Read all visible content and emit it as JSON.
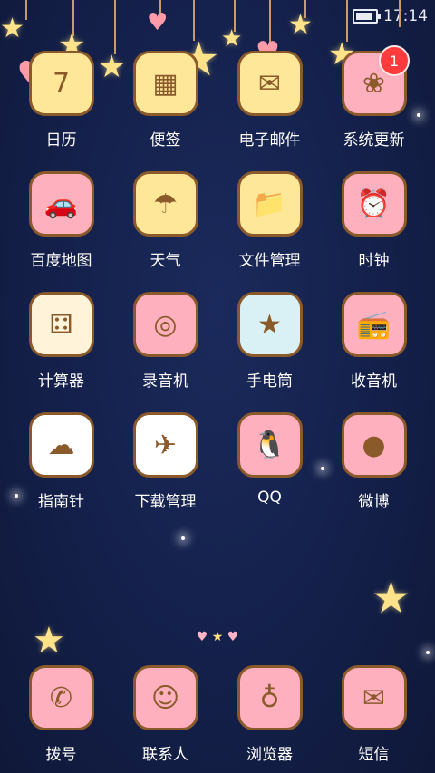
{
  "status_bar": {
    "time": "17:14"
  },
  "apps": [
    {
      "label": "日历",
      "icon": "calendar-icon",
      "glyph": "7",
      "bg": "#ffe79a"
    },
    {
      "label": "便签",
      "icon": "notepad-icon",
      "glyph": "▦",
      "bg": "#ffe79a"
    },
    {
      "label": "电子邮件",
      "icon": "mail-icon",
      "glyph": "✉",
      "bg": "#ffe79a"
    },
    {
      "label": "系统更新",
      "icon": "balloon-update-icon",
      "glyph": "❀",
      "bg": "#ffb0bf",
      "badge": "1"
    },
    {
      "label": "百度地图",
      "icon": "car-icon",
      "glyph": "🚗",
      "bg": "#ffb0bf"
    },
    {
      "label": "天气",
      "icon": "umbrella-icon",
      "glyph": "☂",
      "bg": "#ffe79a"
    },
    {
      "label": "文件管理",
      "icon": "folder-icon",
      "glyph": "📁",
      "bg": "#ffe79a"
    },
    {
      "label": "时钟",
      "icon": "alarm-clock-icon",
      "glyph": "⏰",
      "bg": "#ffb0bf"
    },
    {
      "label": "计算器",
      "icon": "dice-icon",
      "glyph": "⚃",
      "bg": "#fff3d9"
    },
    {
      "label": "录音机",
      "icon": "lollipop-icon",
      "glyph": "◎",
      "bg": "#ffb0bf"
    },
    {
      "label": "手电筒",
      "icon": "star-jar-icon",
      "glyph": "★",
      "bg": "#d9f1f5"
    },
    {
      "label": "收音机",
      "icon": "radio-icon",
      "glyph": "📻",
      "bg": "#ffb0bf"
    },
    {
      "label": "指南针",
      "icon": "cloud-stars-icon",
      "glyph": "☁",
      "bg": "#ffffff"
    },
    {
      "label": "下载管理",
      "icon": "paper-plane-icon",
      "glyph": "✈",
      "bg": "#ffffff"
    },
    {
      "label": "QQ",
      "icon": "penguin-icon",
      "glyph": "🐧",
      "bg": "#ffb0bf"
    },
    {
      "label": "微博",
      "icon": "egg-creature-icon",
      "glyph": "●",
      "bg": "#ffb0bf"
    }
  ],
  "dock": [
    {
      "label": "拨号",
      "icon": "phone-icon",
      "glyph": "✆",
      "bg": "#ffb0bf"
    },
    {
      "label": "联系人",
      "icon": "contacts-girl-icon",
      "glyph": "☺",
      "bg": "#ffb0bf"
    },
    {
      "label": "浏览器",
      "icon": "planet-icon",
      "glyph": "♁",
      "bg": "#ffb0bf"
    },
    {
      "label": "短信",
      "icon": "message-bunny-icon",
      "glyph": "✉",
      "bg": "#ffb0bf"
    }
  ]
}
